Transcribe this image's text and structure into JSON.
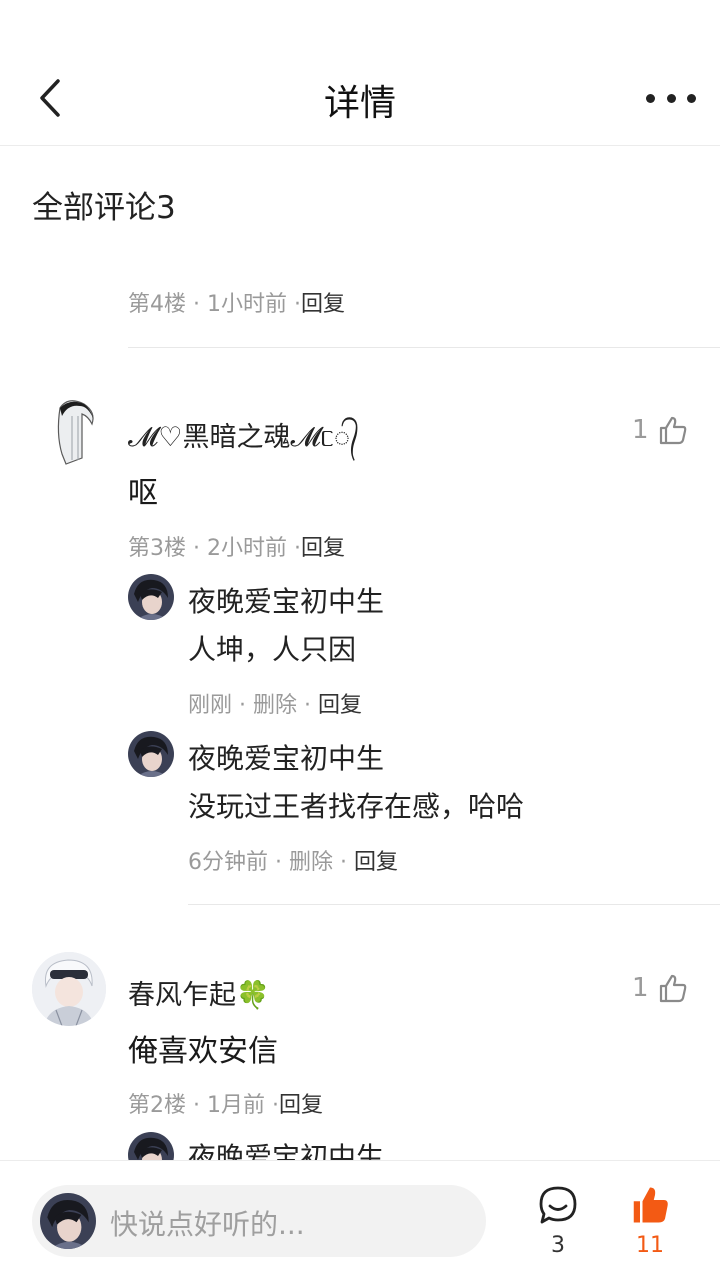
{
  "header": {
    "title": "详情"
  },
  "section": {
    "title": "全部评论",
    "count": "3"
  },
  "comments": [
    {
      "floor": "第4楼",
      "time": "1小时前",
      "reply": "回复"
    },
    {
      "username": "𝓜♡黑暗之魂𝓜ᥴ᭄",
      "text": "呕",
      "likes": "1",
      "floor": "第3楼",
      "time": "2小时前",
      "reply": "回复",
      "replies": [
        {
          "name": "夜晚爱宝初中生",
          "text": "人坤，人只因",
          "time": "刚刚",
          "delete": "删除",
          "reply": "回复"
        },
        {
          "name": "夜晚爱宝初中生",
          "text": "没玩过王者找存在感，哈哈",
          "time": "6分钟前",
          "delete": "删除",
          "reply": "回复"
        }
      ]
    },
    {
      "username": "春风乍起🍀",
      "text": "俺喜欢安信",
      "likes": "1",
      "floor": "第2楼",
      "time": "1月前",
      "reply": "回复",
      "replies": [
        {
          "name": "夜晚爱宝初中生"
        }
      ]
    }
  ],
  "bottom_bar": {
    "placeholder": "快说点好听的...",
    "comment_count": "3",
    "like_count": "11"
  },
  "colors": {
    "accent": "#f35a14",
    "meta": "#9a9a9a"
  },
  "icons": [
    "back-arrow-icon",
    "more-icon",
    "thumbs-up-icon",
    "comment-bubble-icon",
    "thumbs-up-filled-icon"
  ]
}
